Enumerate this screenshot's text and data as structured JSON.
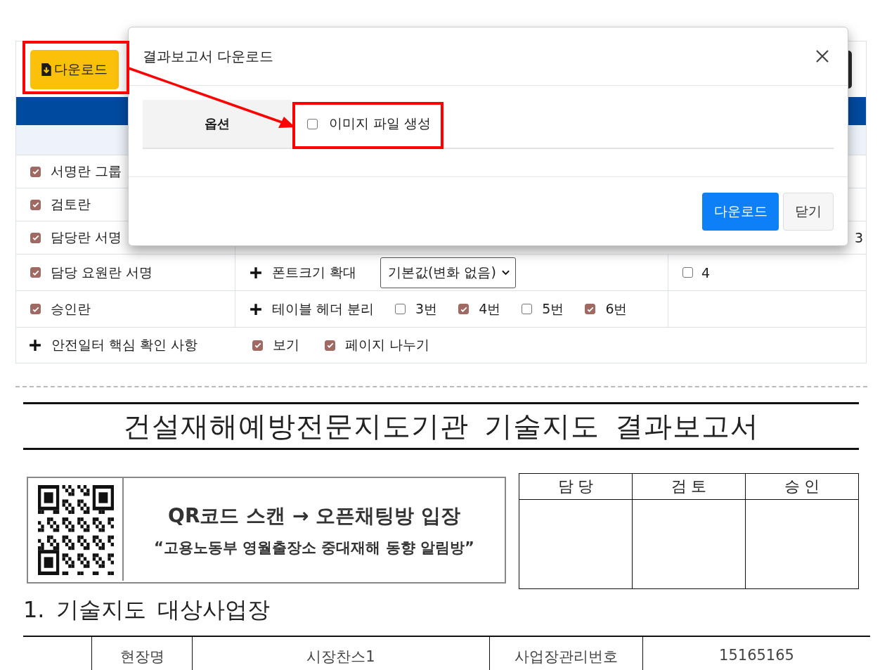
{
  "settings": {
    "download_button": {
      "label": "다운로드"
    },
    "rows": [
      {
        "label": "서명란 그룹",
        "checked": true
      },
      {
        "label": "검토란",
        "checked": true
      },
      {
        "label": "담당란 서명",
        "checked": true,
        "column_3": {
          "kind": "text",
          "text": "3"
        }
      },
      {
        "label": "담당 요원란 서명",
        "checked": true,
        "setting": {
          "kind": "select",
          "label": "폰트크기 확대",
          "value": "기본값(변화 없음)"
        },
        "column_3": {
          "kind": "checkbox",
          "label": "4",
          "checked": false
        }
      },
      {
        "label": "승인란",
        "checked": true,
        "setting": {
          "kind": "checks",
          "label": "테이블 헤더 분리",
          "options": [
            {
              "label": "3번",
              "checked": false
            },
            {
              "label": "4번",
              "checked": true
            },
            {
              "label": "5번",
              "checked": false
            },
            {
              "label": "6번",
              "checked": true
            }
          ]
        }
      }
    ],
    "safety_row": {
      "label": "안전일터 핵심 확인 사항",
      "options": [
        {
          "label": "보기",
          "checked": true
        },
        {
          "label": "페이지 나누기",
          "checked": true
        }
      ]
    }
  },
  "modal": {
    "title": "결과보고서 다운로드",
    "option_label": "옵션",
    "option": {
      "label": "이미지 파일 생성",
      "checked": false
    },
    "buttons": [
      {
        "label": "다운로드",
        "kind": "primary"
      },
      {
        "label": "닫기",
        "kind": "secondary"
      }
    ]
  },
  "document": {
    "title": "건설재해예방전문지도기관 기술지도 결과보고서",
    "banner": {
      "headline": "QR코드 스캔 → 오픈채팅방 입장",
      "subline": "“고용노동부 영월출장소 중대재해 동향 알림방”"
    },
    "approval": {
      "columns": [
        "담 당",
        "검 토",
        "승 인"
      ]
    },
    "section": "1. 기술지도 대상사업장",
    "site_table": {
      "cells": [
        "현장명",
        "시장찬스1",
        "사업장관리번호",
        "15165165"
      ]
    }
  }
}
